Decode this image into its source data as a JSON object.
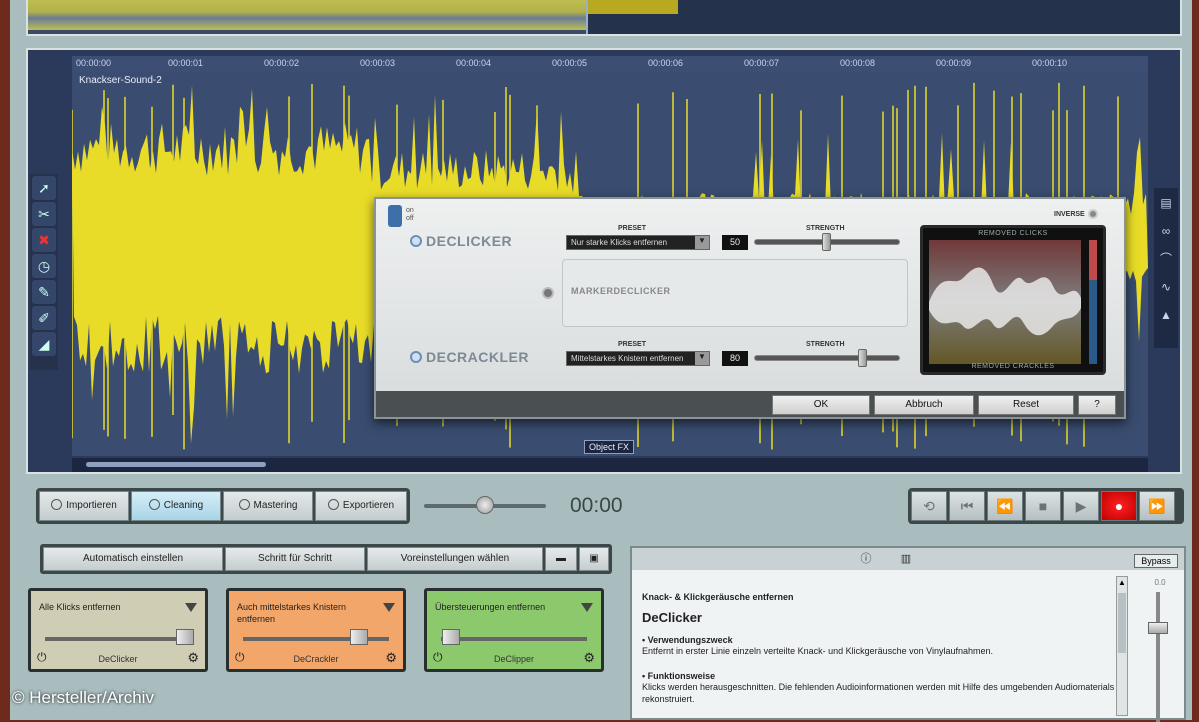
{
  "timeline": {
    "ticks": [
      "00:00:00",
      "00:00:01",
      "00:00:02",
      "00:00:03",
      "00:00:04",
      "00:00:05",
      "00:00:06",
      "00:00:07",
      "00:00:08",
      "00:00:09",
      "00:00:10"
    ],
    "track_name": "Knackser-Sound-2",
    "object_fx": "Object FX"
  },
  "dialog": {
    "on_label": "on",
    "off_label": "off",
    "inverse_label": "INVERSE",
    "declicker": {
      "title": "DECLICKER",
      "preset_label": "PRESET",
      "preset_value": "Nur starke Klicks entfernen",
      "strength_label": "STRENGTH",
      "strength_value": "50"
    },
    "markerdeclicker": {
      "title": "MARKERDECLICKER"
    },
    "decrackler": {
      "title": "DECRACKLER",
      "preset_label": "PRESET",
      "preset_value": "Mittelstarkes Knistern entfernen",
      "strength_label": "STRENGTH",
      "strength_value": "80"
    },
    "meter": {
      "top_label": "REMOVED CLICKS",
      "bottom_label": "REMOVED CRACKLES"
    },
    "buttons": {
      "ok": "OK",
      "cancel": "Abbruch",
      "reset": "Reset",
      "help": "?"
    }
  },
  "modes": {
    "items": [
      {
        "label": "Importieren"
      },
      {
        "label": "Cleaning"
      },
      {
        "label": "Mastering"
      },
      {
        "label": "Exportieren"
      }
    ],
    "active": "Cleaning"
  },
  "transport": {
    "time": "00:00",
    "buttons": [
      "loop",
      "skip-back",
      "rewind",
      "stop",
      "play",
      "record",
      "fast-forward"
    ]
  },
  "auto_bar": {
    "auto": "Automatisch einstellen",
    "step": "Schritt für Schritt",
    "presets": "Voreinstellungen wählen"
  },
  "cards": [
    {
      "title": "Alle Klicks entfernen",
      "name": "DeClicker",
      "color": "#cfcdb4",
      "value": 0.95
    },
    {
      "title": "Auch mittelstarkes Knistern entfernen",
      "name": "DeCrackler",
      "color": "#f2a66a",
      "value": 0.78
    },
    {
      "title": "Übersteuerungen entfernen",
      "name": "DeClipper",
      "color": "#8cc86c",
      "value": 0.02
    }
  ],
  "help": {
    "bypass": "Bypass",
    "fader_label": "0.0",
    "subtitle": "Knack- & Klickgeräusche entfernen",
    "title": "DeClicker",
    "sections": [
      {
        "heading": "• Verwendungszweck",
        "text": "Entfernt in erster Linie einzeln verteilte Knack- und Klickgeräusche von Vinylaufnahmen."
      },
      {
        "heading": "• Funktionsweise",
        "text": "Klicks werden herausgeschnitten. Die fehlenden Audioinformationen werden mit Hilfe des umgebenden Audiomaterials rekonstruiert."
      }
    ]
  },
  "credit": "© Hersteller/Archiv",
  "colors": {
    "wave": "#e8dc28",
    "wave_bg": "#3a4d70",
    "record": "#e00000"
  }
}
